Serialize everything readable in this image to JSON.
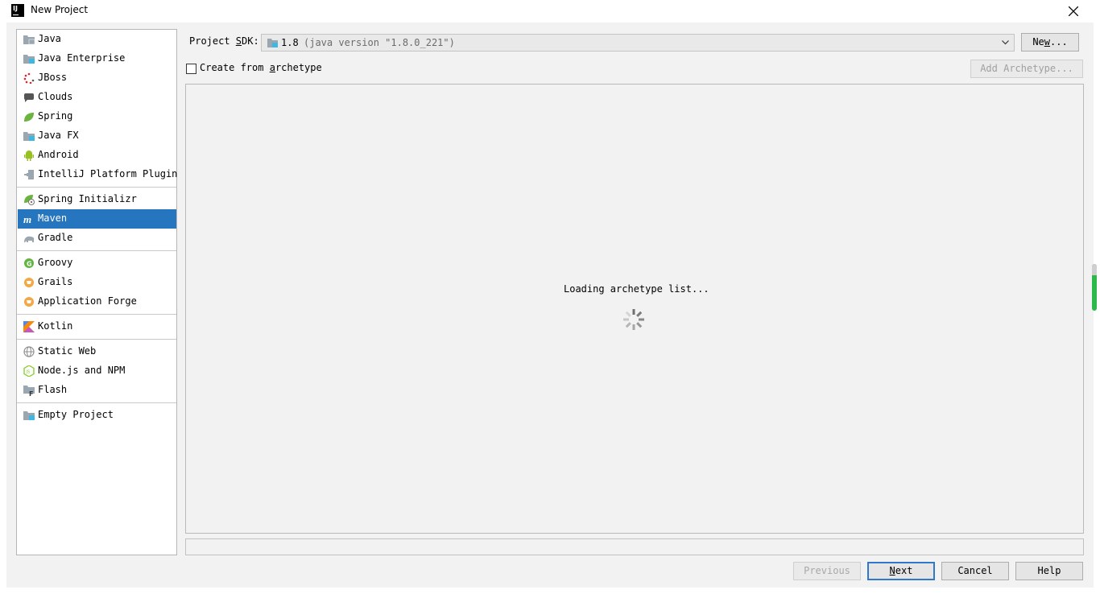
{
  "window": {
    "title": "New Project",
    "icon_text": "IJ"
  },
  "sidebar": {
    "groups": [
      [
        {
          "label": "Java",
          "icon": "java-folder-icon"
        },
        {
          "label": "Java Enterprise",
          "icon": "java-enterprise-icon"
        },
        {
          "label": "JBoss",
          "icon": "jboss-icon"
        },
        {
          "label": "Clouds",
          "icon": "clouds-icon"
        },
        {
          "label": "Spring",
          "icon": "spring-leaf-icon"
        },
        {
          "label": "Java FX",
          "icon": "javafx-folder-icon"
        },
        {
          "label": "Android",
          "icon": "android-icon"
        },
        {
          "label": "IntelliJ Platform Plugin",
          "icon": "plugin-icon"
        }
      ],
      [
        {
          "label": "Spring Initializr",
          "icon": "spring-initializr-icon"
        },
        {
          "label": "Maven",
          "icon": "maven-icon",
          "selected": true
        },
        {
          "label": "Gradle",
          "icon": "gradle-elephant-icon"
        }
      ],
      [
        {
          "label": "Groovy",
          "icon": "groovy-icon"
        },
        {
          "label": "Grails",
          "icon": "grails-icon"
        },
        {
          "label": "Application Forge",
          "icon": "application-forge-icon"
        }
      ],
      [
        {
          "label": "Kotlin",
          "icon": "kotlin-icon"
        }
      ],
      [
        {
          "label": "Static Web",
          "icon": "globe-icon"
        },
        {
          "label": "Node.js and NPM",
          "icon": "nodejs-icon"
        },
        {
          "label": "Flash",
          "icon": "flash-folder-icon"
        }
      ],
      [
        {
          "label": "Empty Project",
          "icon": "empty-project-icon"
        }
      ]
    ]
  },
  "sdk": {
    "label_pre": "Project ",
    "label_mnemonic": "S",
    "label_post": "DK:",
    "version": "1.8",
    "detail": "(java version \"1.8.0_221\")",
    "new_pre": "Ne",
    "new_mnemonic": "w",
    "new_post": "..."
  },
  "archetype": {
    "checkbox_pre": "Create from ",
    "checkbox_mnemonic": "a",
    "checkbox_post": "rchetype",
    "checked": false,
    "add_button": "Add Archetype...",
    "loading_text": "Loading archetype list..."
  },
  "footer": {
    "previous": "Previous",
    "next_mnemonic": "N",
    "next_post": "ext",
    "cancel": "Cancel",
    "help": "Help"
  },
  "colors": {
    "selection": "#2675bf",
    "default_button_border": "#2f78cc",
    "scroll_indicator": "#2cb84a"
  }
}
